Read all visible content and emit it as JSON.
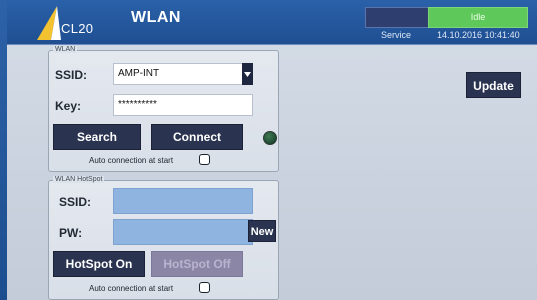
{
  "header": {
    "logo_text": "CL20",
    "title": "WLAN",
    "status": "Idle",
    "service_label": "Service",
    "datetime": "14.10.2016 10:41:40"
  },
  "wlan": {
    "legend": "WLAN",
    "ssid_label": "SSID:",
    "ssid_value": "AMP-INT",
    "key_label": "Key:",
    "key_value": "**********",
    "search_label": "Search",
    "connect_label": "Connect",
    "auto_connect_label": "Auto connection at start",
    "auto_connect_checked": false
  },
  "hotspot": {
    "legend": "WLAN HotSpot",
    "ssid_label": "SSID:",
    "ssid_value": "",
    "pw_label": "PW:",
    "pw_value": "",
    "new_label": "New",
    "on_label": "HotSpot On",
    "off_label": "HotSpot Off",
    "auto_connect_label": "Auto connection at start",
    "auto_connect_checked": false
  },
  "update_label": "Update",
  "colors": {
    "header_bg": "#2a61a9",
    "button_bg": "#2a3450",
    "status_idle_bg": "#5fc85a",
    "field_blue": "#8fb4e0",
    "led": "#2d6b46"
  },
  "icons": [
    "logo-icon",
    "dropdown-arrow-icon",
    "status-led-icon"
  ]
}
